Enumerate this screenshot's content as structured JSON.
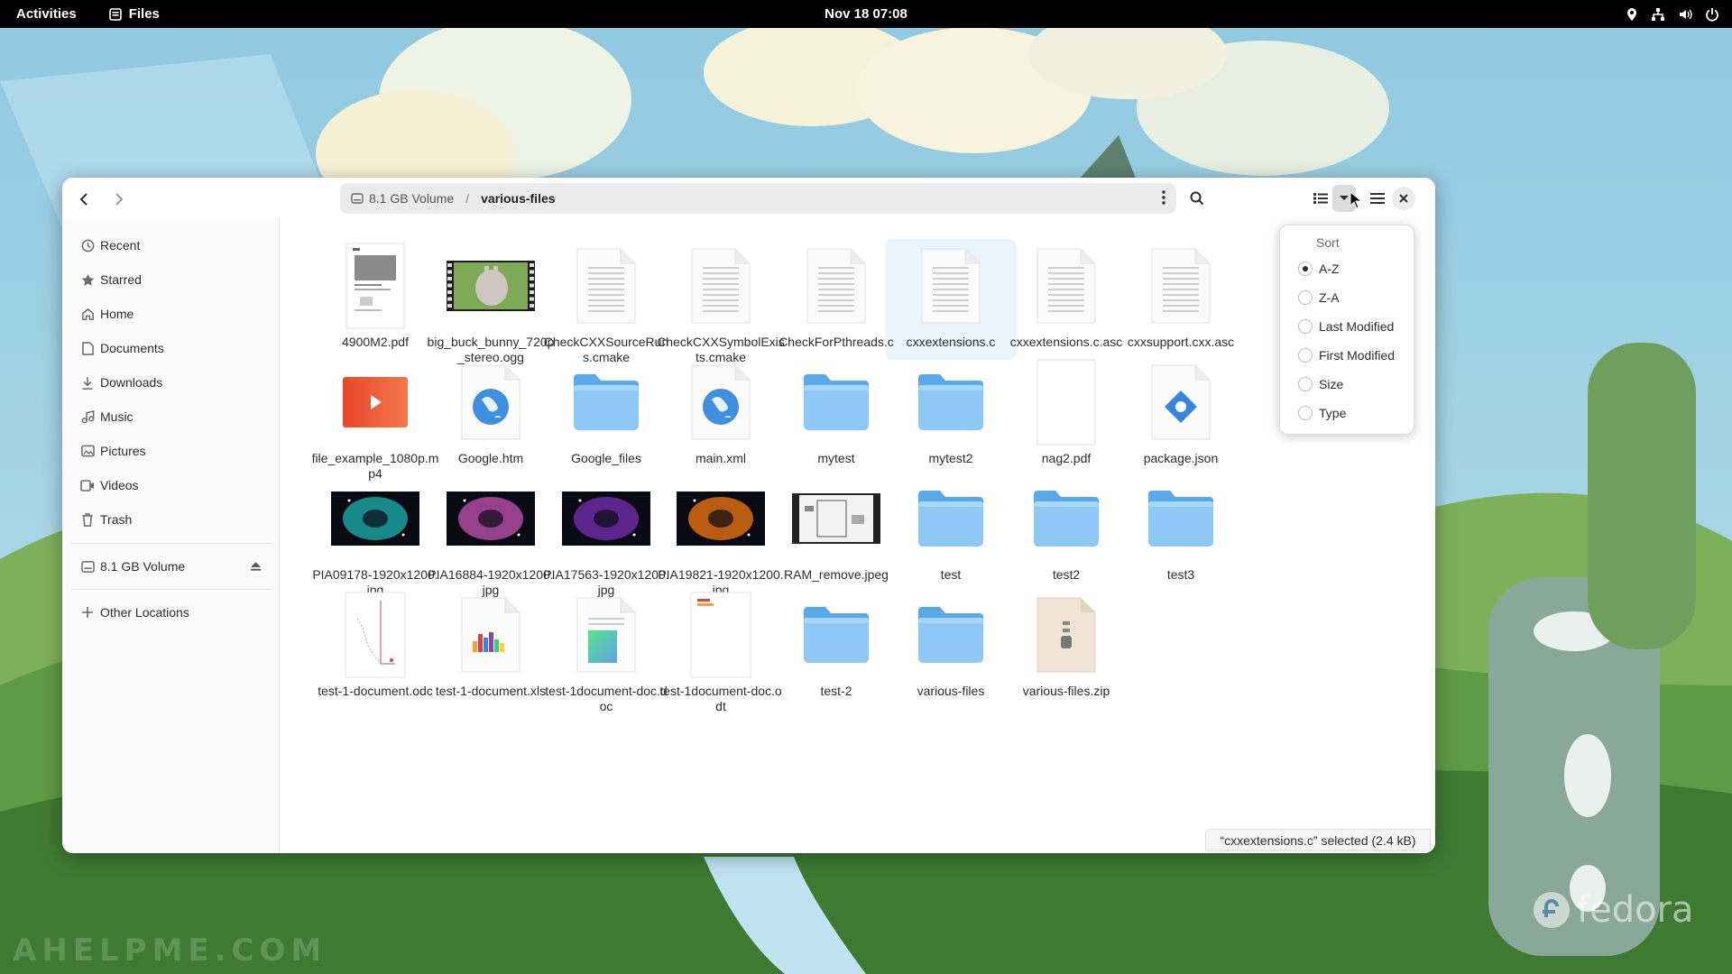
{
  "topbar": {
    "activities": "Activities",
    "app_name": "Files",
    "clock": "Nov 18  07:08"
  },
  "window": {
    "pathbar": {
      "volume": "8.1 GB Volume",
      "separator": "/",
      "current": "various-files"
    }
  },
  "sidebar": {
    "items": [
      {
        "label": "Recent",
        "icon": "clock-icon"
      },
      {
        "label": "Starred",
        "icon": "star-icon"
      },
      {
        "label": "Home",
        "icon": "home-icon"
      },
      {
        "label": "Documents",
        "icon": "document-icon"
      },
      {
        "label": "Downloads",
        "icon": "download-icon"
      },
      {
        "label": "Music",
        "icon": "music-icon"
      },
      {
        "label": "Pictures",
        "icon": "picture-icon"
      },
      {
        "label": "Videos",
        "icon": "video-icon"
      },
      {
        "label": "Trash",
        "icon": "trash-icon"
      }
    ],
    "volume": "8.1 GB Volume",
    "other_locations": "Other Locations"
  },
  "files": [
    {
      "name": "4900M2.pdf",
      "kind": "pdf"
    },
    {
      "name": "big_buck_bunny_720p_stereo.ogg",
      "kind": "video-thumb"
    },
    {
      "name": "CheckCXXSourceRuns.cmake",
      "kind": "text"
    },
    {
      "name": "CheckCXXSymbolExists.cmake",
      "kind": "text"
    },
    {
      "name": "CheckForPthreads.c",
      "kind": "text"
    },
    {
      "name": "cxxextensions.c",
      "kind": "text",
      "selected": true
    },
    {
      "name": "cxxextensions.c.asc",
      "kind": "text"
    },
    {
      "name": "cxxsupport.cxx.asc",
      "kind": "text"
    },
    {
      "name": "file_example_1080p.mp4",
      "kind": "video"
    },
    {
      "name": "Google.htm",
      "kind": "web"
    },
    {
      "name": "Google_files",
      "kind": "folder"
    },
    {
      "name": "main.xml",
      "kind": "web"
    },
    {
      "name": "mytest",
      "kind": "folder"
    },
    {
      "name": "mytest2",
      "kind": "folder"
    },
    {
      "name": "nag2.pdf",
      "kind": "pdf-hidden"
    },
    {
      "name": "package.json",
      "kind": "json"
    },
    {
      "name": "PIA09178-1920x1200.jpg",
      "kind": "image",
      "color": "#1aa0a0"
    },
    {
      "name": "PIA16884-1920x1200.jpg",
      "kind": "image",
      "color": "#b04aa0"
    },
    {
      "name": "PIA17563-1920x1200.jpg",
      "kind": "image",
      "color": "#6a2aa0"
    },
    {
      "name": "PIA19821-1920x1200.jpg",
      "kind": "image",
      "color": "#d86a10"
    },
    {
      "name": "RAM_remove.jpeg",
      "kind": "image-doc"
    },
    {
      "name": "test",
      "kind": "folder"
    },
    {
      "name": "test2",
      "kind": "folder"
    },
    {
      "name": "test3",
      "kind": "folder"
    },
    {
      "name": "test-1-document.odc",
      "kind": "chart-doc"
    },
    {
      "name": "test-1-document.xls",
      "kind": "spreadsheet"
    },
    {
      "name": "test-1document-doc.doc",
      "kind": "doc"
    },
    {
      "name": "test-1document-doc.odt",
      "kind": "odt"
    },
    {
      "name": "test-2",
      "kind": "folder"
    },
    {
      "name": "various-files",
      "kind": "folder"
    },
    {
      "name": "various-files.zip",
      "kind": "zip"
    }
  ],
  "sort_menu": {
    "title": "Sort",
    "options": [
      "A-Z",
      "Z-A",
      "Last Modified",
      "First Modified",
      "Size",
      "Type"
    ],
    "selected": "A-Z"
  },
  "statusbar": "“cxxextensions.c” selected  (2.4 kB)",
  "watermark": "AHELPME.COM",
  "distro_logo": "fedora",
  "colors": {
    "folder": "#8ec8f4",
    "accent": "#3584e4",
    "topbar": "#000000"
  }
}
